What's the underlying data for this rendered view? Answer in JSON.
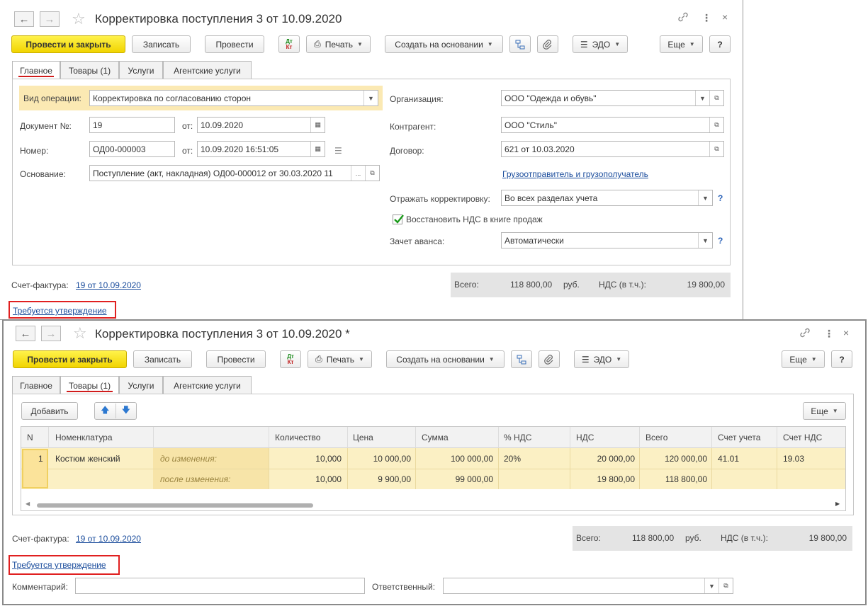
{
  "colors": {
    "accent": "#f5d800",
    "link": "#1a4c9c",
    "highlight_row": "#fbe9b3",
    "red_marker": "#e02020"
  },
  "window1": {
    "title": "Корректировка поступления 3 от 10.09.2020",
    "toolbar": {
      "post_and_close": "Провести и закрыть",
      "save": "Записать",
      "post": "Провести",
      "dtkt_top": "Дт",
      "dtkt_bottom": "Кт",
      "print": "Печать",
      "create_based": "Создать на основании",
      "edo": "ЭДО",
      "more": "Еще",
      "help": "?"
    },
    "tabs": [
      "Главное",
      "Товары (1)",
      "Услуги",
      "Агентские услуги"
    ],
    "form": {
      "operation_label": "Вид операции:",
      "operation_value": "Корректировка по согласованию сторон",
      "doc_no_label": "Документ №:",
      "doc_no_value": "19",
      "from_label": "от:",
      "doc_date": "10.09.2020",
      "number_label": "Номер:",
      "number_value": "ОД00-000003",
      "number_date": "10.09.2020 16:51:05",
      "basis_label": "Основание:",
      "basis_value": "Поступление (акт, накладная) ОД00-000012 от 30.03.2020 11",
      "org_label": "Организация:",
      "org_value": "ООО \"Одежда и обувь\"",
      "contractor_label": "Контрагент:",
      "contractor_value": "ООО \"Стиль\"",
      "contract_label": "Договор:",
      "contract_value": "621 от 10.03.2020",
      "shipper_link": "Грузоотправитель и грузополучатель",
      "reflect_label": "Отражать корректировку:",
      "reflect_value": "Во всех разделах учета",
      "vat_restore": "Восстановить НДС в книге продаж",
      "advance_label": "Зачет аванса:",
      "advance_value": "Автоматически",
      "help_q": "?"
    },
    "invoice_label": "Счет-фактура:",
    "invoice_link": "19 от 10.09.2020",
    "totals": {
      "total_label": "Всего:",
      "total_value": "118 800,00",
      "currency": "руб.",
      "vat_label": "НДС (в т.ч.):",
      "vat_value": "19 800,00"
    },
    "approval_link": "Требуется утверждение"
  },
  "window2": {
    "title": "Корректировка поступления 3 от 10.09.2020 *",
    "toolbar": {
      "post_and_close": "Провести и закрыть",
      "save": "Записать",
      "post": "Провести",
      "dtkt_top": "Дт",
      "dtkt_bottom": "Кт",
      "print": "Печать",
      "create_based": "Создать на основании",
      "edo": "ЭДО",
      "more": "Еще",
      "help": "?"
    },
    "tabs": [
      "Главное",
      "Товары (1)",
      "Услуги",
      "Агентские услуги"
    ],
    "table_toolbar": {
      "add": "Добавить",
      "more": "Еще"
    },
    "columns": [
      "N",
      "Номенклатура",
      "Количество",
      "Цена",
      "Сумма",
      "% НДС",
      "НДС",
      "Всего",
      "Счет учета",
      "Счет НДС"
    ],
    "row": {
      "n": "1",
      "item": "Костюм женский",
      "before_label": "до изменения:",
      "after_label": "после изменения:",
      "before": {
        "qty": "10,000",
        "price": "10 000,00",
        "sum": "100 000,00",
        "vat_rate": "20%",
        "vat": "20 000,00",
        "total": "120 000,00",
        "account": "41.01",
        "vat_account": "19.03"
      },
      "after": {
        "qty": "10,000",
        "price": "9 900,00",
        "sum": "99 000,00",
        "vat": "19 800,00",
        "total": "118 800,00"
      }
    },
    "invoice_label": "Счет-фактура:",
    "invoice_link": "19 от 10.09.2020",
    "totals": {
      "total_label": "Всего:",
      "total_value": "118 800,00",
      "currency": "руб.",
      "vat_label": "НДС (в т.ч.):",
      "vat_value": "19 800,00"
    },
    "approval_link": "Требуется утверждение",
    "comment_label": "Комментарий:",
    "comment_value": "",
    "responsible_label": "Ответственный:",
    "responsible_value": ""
  }
}
